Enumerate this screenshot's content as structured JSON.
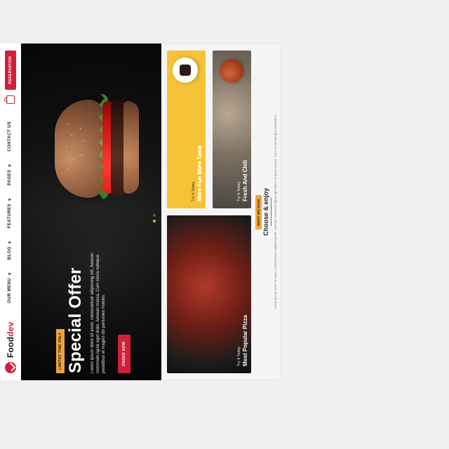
{
  "nav": {
    "logo_text": "Food",
    "logo_accent": "dev",
    "menu": [
      {
        "label": "OUR MENU"
      },
      {
        "label": "BLOG"
      },
      {
        "label": "FEATURES"
      },
      {
        "label": "PAGES"
      },
      {
        "label": "CONTACT US"
      }
    ],
    "reserve_label": "RESERVATION"
  },
  "hero": {
    "tag": "LIMITED TIME ONLY",
    "title": "Special Offer",
    "text": "Lorem ipsum dolor sit amet, consectetuer adipiscing elit. Aenean commodo ligula eget dolor. Aenean massa. Cum sociis natoque penatibus et magnis dis parturient montes.",
    "cta": "ORDER NOW"
  },
  "promos": {
    "pizza": {
      "label": "Try It Today",
      "title": "Most Popular Pizza"
    },
    "yellow": {
      "label": "Try It Today",
      "title": "More Fun More Taste"
    },
    "grey": {
      "label": "Try It Today",
      "title": "Fresh And Chili"
    }
  },
  "choose": {
    "tag": "WHAT WE HAVE",
    "title": "Choose & enjoy",
    "desc": "Lorem ipsum dolor sit amet, consectetuer adipiscing elit. Aenean commodo ligula eget dolor. Aenean massa. Cum sociis natoque penatibus."
  },
  "colors": {
    "brand_red": "#d11f3a",
    "accent_orange": "#f1a43a",
    "promo_yellow": "#f6c237"
  },
  "icons": {
    "logo": "foodie-logo-icon",
    "cart": "cart-icon",
    "chevron": "chevron-down-icon",
    "slider_dot": "slider-dot"
  }
}
